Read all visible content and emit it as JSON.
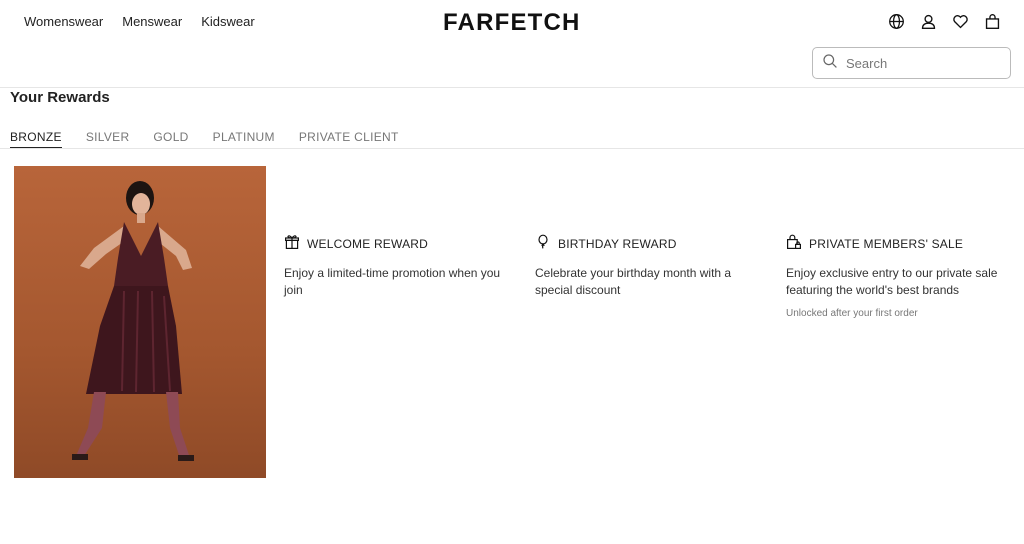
{
  "nav": {
    "items": [
      "Womenswear",
      "Menswear",
      "Kidswear"
    ]
  },
  "brand": {
    "logo": "FARFETCH"
  },
  "header_icons": [
    "globe-icon",
    "account-icon",
    "heart-icon",
    "bag-icon"
  ],
  "search": {
    "placeholder": "Search",
    "value": ""
  },
  "page": {
    "title": "Your Rewards"
  },
  "tabs": [
    {
      "label": "BRONZE",
      "active": true
    },
    {
      "label": "SILVER",
      "active": false
    },
    {
      "label": "GOLD",
      "active": false
    },
    {
      "label": "PLATINUM",
      "active": false
    },
    {
      "label": "PRIVATE CLIENT",
      "active": false
    }
  ],
  "rewards": [
    {
      "icon": "gift-icon",
      "title": "WELCOME REWARD",
      "description": "Enjoy a limited-time promotion when you join",
      "note": ""
    },
    {
      "icon": "balloon-icon",
      "title": "BIRTHDAY REWARD",
      "description": "Celebrate your birthday month with a special discount",
      "note": ""
    },
    {
      "icon": "shopping-bag-lock-icon",
      "title": "PRIVATE MEMBERS' SALE",
      "description": "Enjoy exclusive entry to our private sale featuring the world's best brands",
      "note": "Unlocked after your first order"
    }
  ],
  "colors": {
    "text": "#222222",
    "muted": "#777777",
    "hero_background": "#a4572f",
    "dress": "#4a1c24"
  }
}
